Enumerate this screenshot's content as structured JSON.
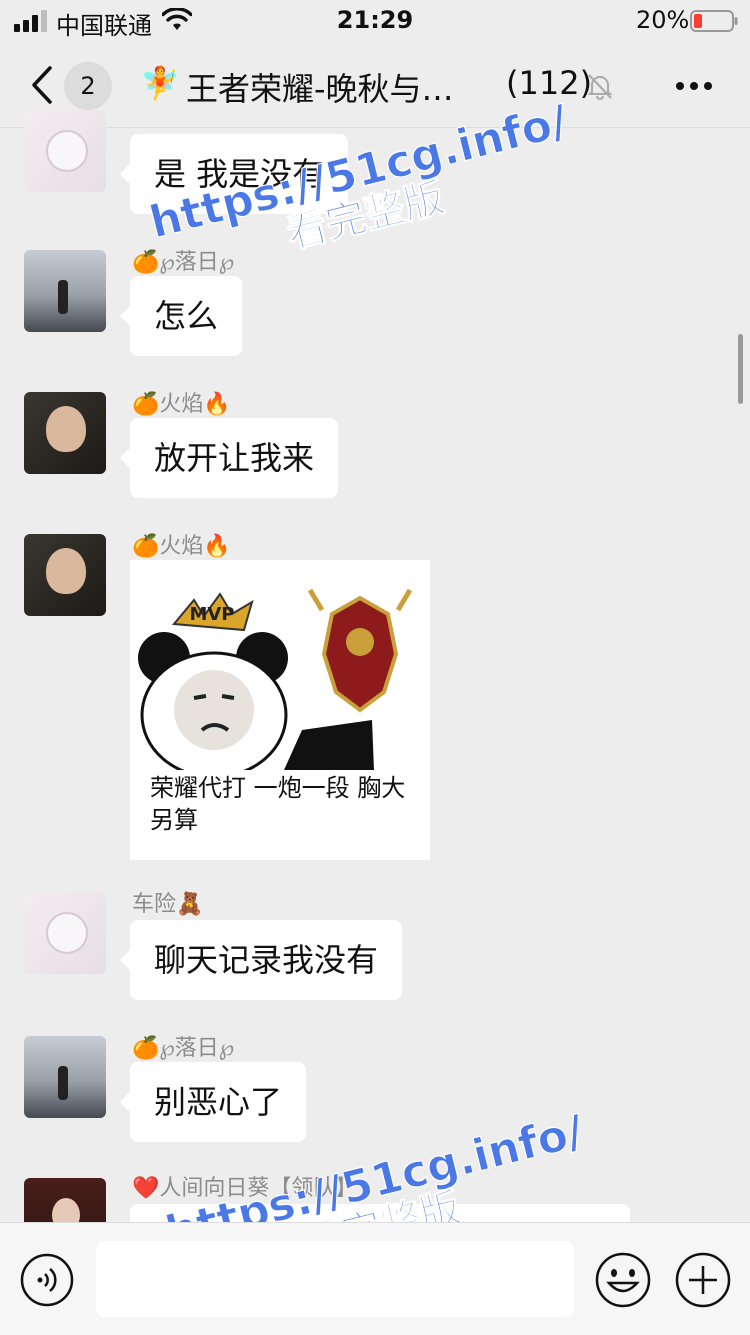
{
  "status_bar": {
    "carrier": "中国联通",
    "time": "21:29",
    "battery": "20%",
    "battery_color": "#ff3b30"
  },
  "nav": {
    "unread_count": "2",
    "group_emoji": "🧚",
    "title": "王者荣耀-晚秋与…",
    "member_count": "(112)",
    "icons": [
      "back-chevron-icon",
      "mute-bell-icon",
      "more-icon"
    ]
  },
  "messages": [
    {
      "sender": "",
      "text": "是 我是没有",
      "avatar": "anime-girl"
    },
    {
      "sender": "🍊℘落日℘",
      "text": "怎么",
      "avatar": "mountain-person"
    },
    {
      "sender": "🍊火焰🔥",
      "text": "放开让我来",
      "avatar": "boy"
    },
    {
      "sender": "🍊火焰🔥",
      "sticker_caption": "荣耀代打 一炮一段 胸大另算",
      "sticker_badge": "MVP",
      "avatar": "boy"
    },
    {
      "sender": "车险🧸",
      "text": "聊天记录我没有",
      "avatar": "anime-girl"
    },
    {
      "sender": "🍊℘落日℘",
      "text": "别恶心了",
      "avatar": "mountain-person"
    },
    {
      "sender": "❤️人间向日葵【领队】",
      "text": "",
      "avatar": "girl"
    }
  ],
  "watermarks": [
    {
      "url": "https://51cg.info/",
      "sub": "看完整版"
    },
    {
      "url": "https://51cg.info/",
      "sub": "看完整版"
    }
  ],
  "input_bar": {
    "icons": [
      "voice-icon",
      "emoji-icon",
      "plus-icon"
    ]
  },
  "colors": {
    "background": "#ededed",
    "bubble": "#ffffff",
    "watermark": "#4a78e6",
    "sender_text": "#8c8c8c"
  }
}
